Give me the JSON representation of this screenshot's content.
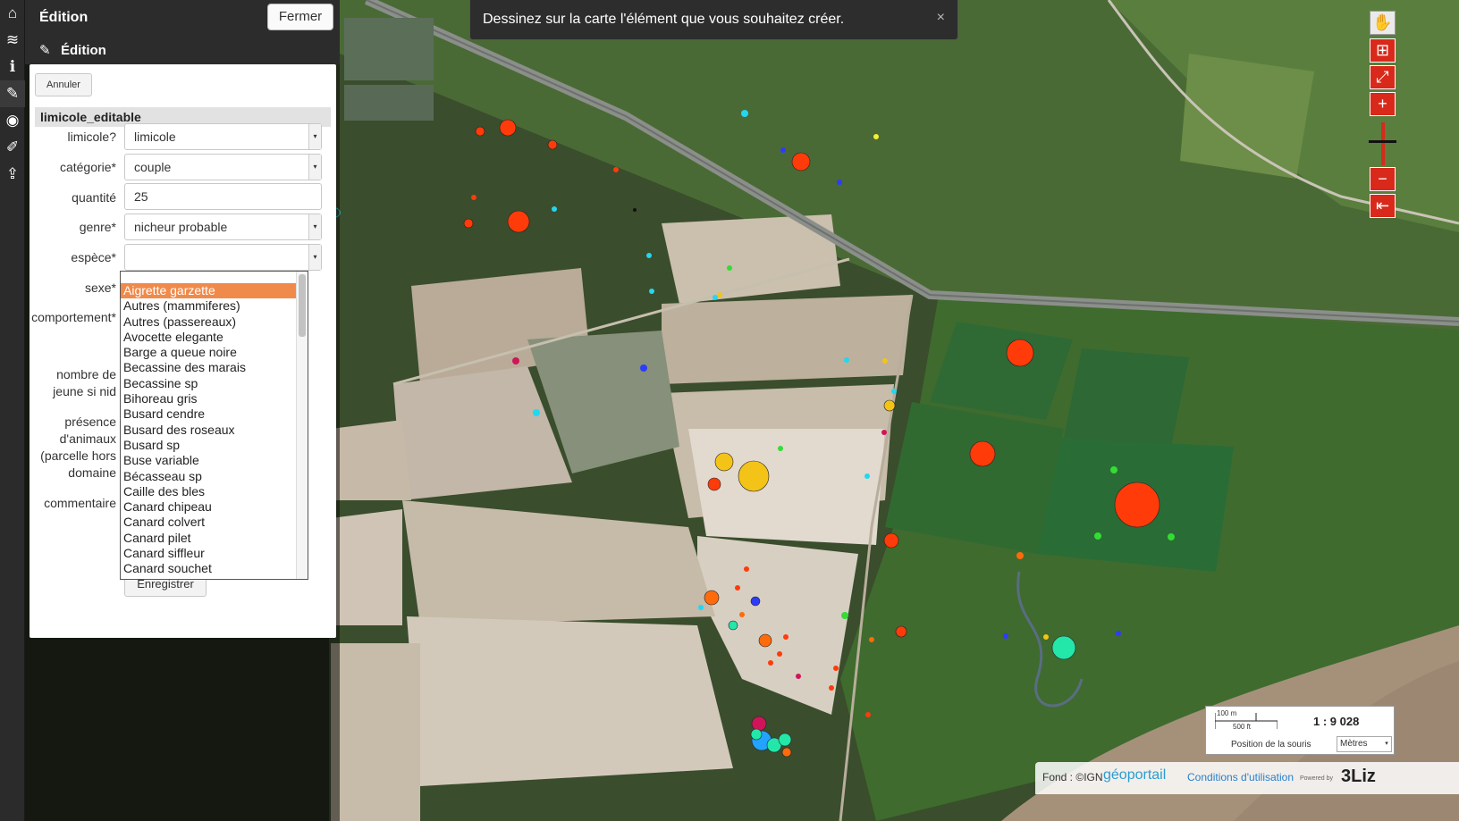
{
  "panel": {
    "title": "Édition",
    "close_label": "Fermer",
    "subtitle": "Édition"
  },
  "form": {
    "cancel_label": "Annuler",
    "layer_name": "limicole_editable",
    "fields": {
      "limicole": {
        "label": "limicole?",
        "value": "limicole"
      },
      "categorie": {
        "label": "catégorie*",
        "value": "couple"
      },
      "quantite": {
        "label": "quantité",
        "value": "25"
      },
      "genre": {
        "label": "genre*",
        "value": "nicheur probable"
      },
      "espece": {
        "label": "espèce*",
        "value": ""
      },
      "sexe": {
        "label": "sexe*"
      },
      "comportement": {
        "label": "comportement*"
      },
      "nombre_jeune": {
        "label_line1": "nombre de",
        "label_line2": "jeune si nid"
      },
      "presence": {
        "label_line1": "présence",
        "label_line2": "d'animaux",
        "label_line3": "(parcelle hors",
        "label_line4": "domaine"
      },
      "commentaire": {
        "label": "commentaire"
      }
    },
    "save_label": "Enregistrer"
  },
  "dropdown": {
    "items": [
      "Aigrette garzette",
      "Autres (mammiferes)",
      "Autres (passereaux)",
      "Avocette elegante",
      "Barge a queue noire",
      "Becassine des marais",
      "Becassine sp",
      "Bihoreau gris",
      "Busard cendre",
      "Busard des roseaux",
      "Busard sp",
      "Buse variable",
      "Bécasseau sp",
      "Caille des bles",
      "Canard chipeau",
      "Canard colvert",
      "Canard pilet",
      "Canard siffleur",
      "Canard souchet"
    ],
    "highlighted": "Aigrette garzette"
  },
  "notice": {
    "text": "Dessinez sur la carte l'élément que vous souhaitez créer.",
    "close": "×"
  },
  "scale": {
    "top_label": "100 m",
    "bottom_label": "500 ft",
    "ratio": "1 : 9 028",
    "mouse_position_label": "Position de la souris",
    "units": "Mètres"
  },
  "attribution": {
    "fond": "Fond : ©IGN",
    "geoportail": "géoportail",
    "conditions": "Conditions d'utilisation",
    "powered": "Powered by",
    "logo": "3Liz"
  },
  "colors": {
    "accent": "#d8291a",
    "highlight": "#f08a4b",
    "panel_dark": "#2c2c2c"
  },
  "icons": {
    "dock": [
      "home-icon",
      "layers-icon",
      "info-icon",
      "edit-icon",
      "locate-icon",
      "draw-icon",
      "share-icon"
    ],
    "map_controls": [
      "pan-icon",
      "zoom-box-icon",
      "zoom-extent-icon",
      "zoom-in-icon",
      "zoom-out-icon",
      "previous-view-icon"
    ]
  }
}
